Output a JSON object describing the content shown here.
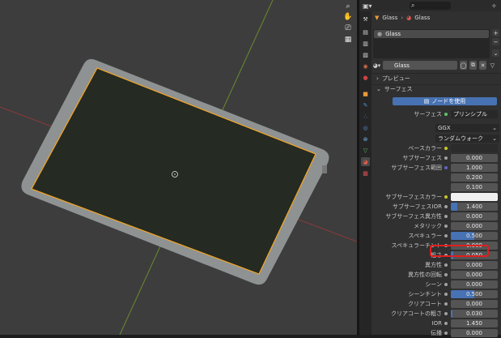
{
  "viewport": {
    "tools": [
      "zoom-icon",
      "hand-icon",
      "camera-icon",
      "grid-icon"
    ]
  },
  "header": {
    "editor_icon": "properties-editor-icon",
    "pin_icon": "pin-icon"
  },
  "breadcrumb": {
    "object": "Glass",
    "material": "Glass"
  },
  "slots": {
    "items": [
      "Glass"
    ]
  },
  "material": {
    "name": "Glass"
  },
  "sections": {
    "preview": "プレビュー",
    "surface": "サーフェス"
  },
  "use_nodes_label": "ノードを使用",
  "surface_row": {
    "label": "サーフェス",
    "value": "プリンシプルBSDF"
  },
  "distribution": "GGX",
  "subsurface_method": "ランダムウォーク",
  "properties": [
    {
      "label": "ベースカラー",
      "value": "",
      "type": "color",
      "swatch": "#2b2b2b",
      "socket": "#c7c729"
    },
    {
      "label": "サブサーフェス",
      "value": "0.000",
      "type": "float",
      "fill": 0,
      "socket": "#a1a1a1"
    },
    {
      "label": "サブサーフェス範囲",
      "value": "1.000",
      "type": "vector",
      "socket": "#6363c7"
    },
    {
      "label": "",
      "value": "0.200",
      "type": "vector-sub"
    },
    {
      "label": "",
      "value": "0.100",
      "type": "vector-sub"
    },
    {
      "label": "サブサーフェスカラー",
      "value": "",
      "type": "color",
      "swatch": "#f0f0f0",
      "socket": "#c7c729"
    },
    {
      "label": "サブサーフェスIOR",
      "value": "1.400",
      "type": "float",
      "fill": 0.14,
      "socket": "#a1a1a1"
    },
    {
      "label": "サブサーフェス異方性",
      "value": "0.000",
      "type": "float",
      "fill": 0,
      "socket": "#a1a1a1"
    },
    {
      "label": "メタリック",
      "value": "0.000",
      "type": "float",
      "fill": 0,
      "socket": "#a1a1a1"
    },
    {
      "label": "スペキュラー",
      "value": "0.500",
      "type": "float",
      "fill": 0.5,
      "socket": "#a1a1a1"
    },
    {
      "label": "スペキュラーチント",
      "value": "0.000",
      "type": "float",
      "fill": 0,
      "socket": "#a1a1a1"
    },
    {
      "label": "粗さ",
      "value": "0.050",
      "type": "float",
      "fill": 0.05,
      "socket": "#a1a1a1"
    },
    {
      "label": "異方性",
      "value": "0.000",
      "type": "float",
      "fill": 0,
      "socket": "#a1a1a1"
    },
    {
      "label": "異方性の回転",
      "value": "0.000",
      "type": "float",
      "fill": 0,
      "socket": "#a1a1a1"
    },
    {
      "label": "シーン",
      "value": "0.000",
      "type": "float",
      "fill": 0,
      "socket": "#a1a1a1"
    },
    {
      "label": "シーンチント",
      "value": "0.500",
      "type": "float",
      "fill": 0.5,
      "socket": "#a1a1a1"
    },
    {
      "label": "クリアコート",
      "value": "0.000",
      "type": "float",
      "fill": 0,
      "socket": "#a1a1a1"
    },
    {
      "label": "クリアコートの粗さ",
      "value": "0.030",
      "type": "float",
      "fill": 0.03,
      "socket": "#a1a1a1"
    },
    {
      "label": "IOR",
      "value": "1.450",
      "type": "float",
      "fill": 0,
      "socket": "#a1a1a1"
    },
    {
      "label": "伝播",
      "value": "0.000",
      "type": "float",
      "fill": 0,
      "socket": "#a1a1a1"
    }
  ],
  "colors": {
    "accent": "#4772b3",
    "selection_outline": "#f5a623",
    "highlight_box": "#e01e1e"
  }
}
